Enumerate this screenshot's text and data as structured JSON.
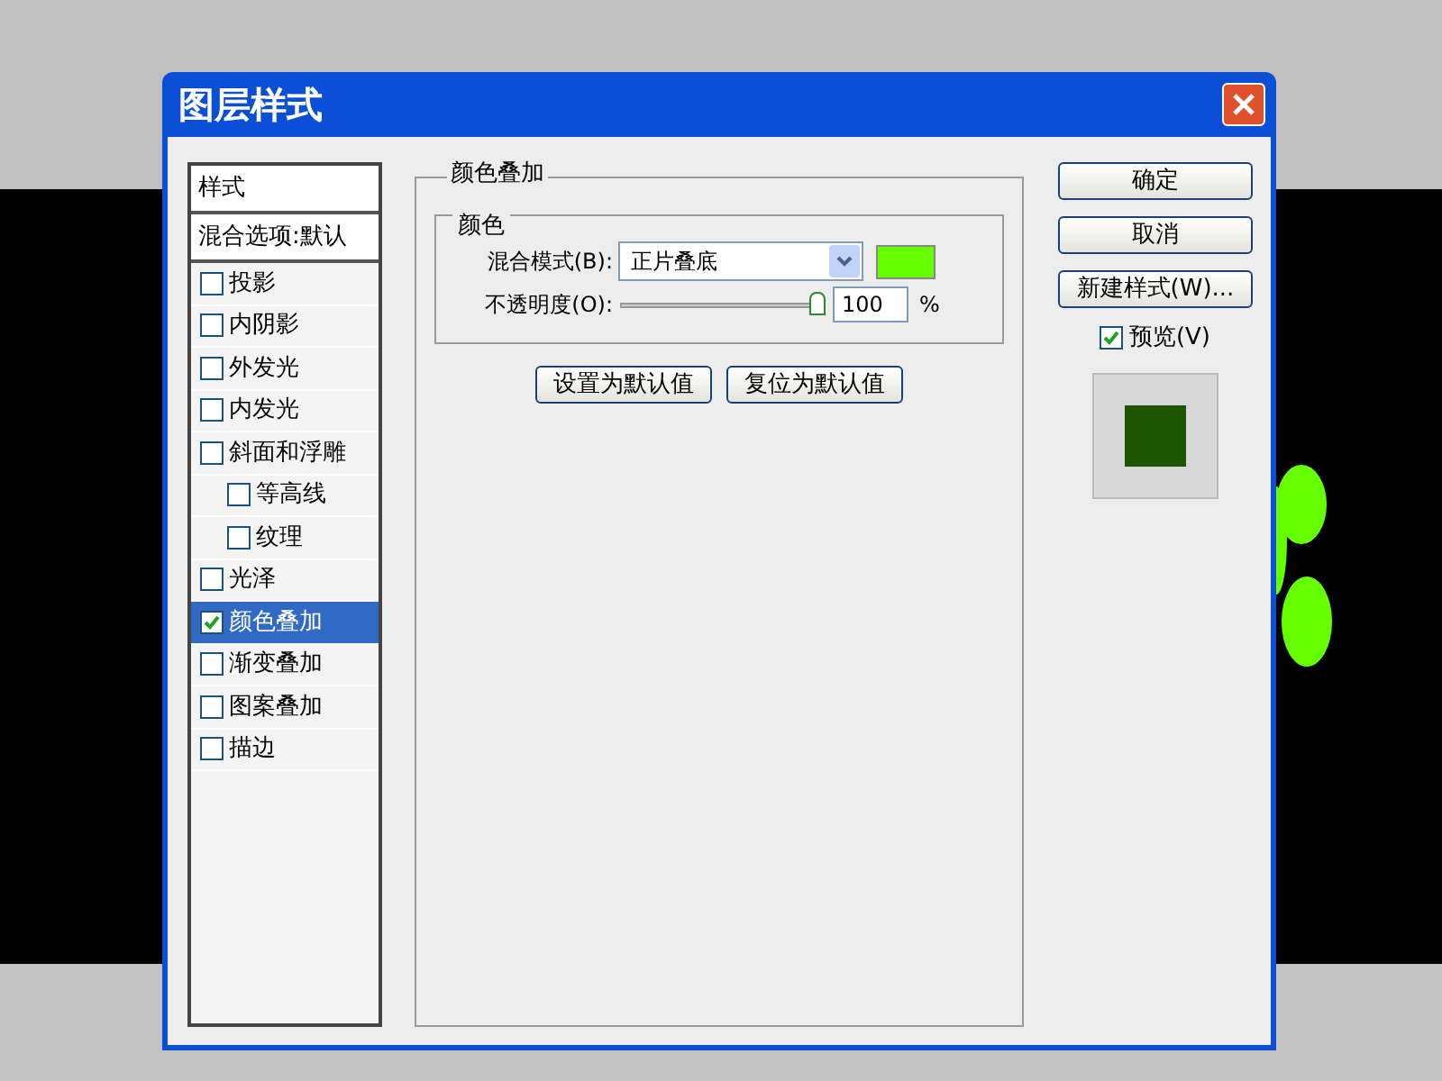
{
  "window": {
    "title": "图层样式"
  },
  "sidebar": {
    "items": [
      {
        "kind": "header",
        "label": "样式"
      },
      {
        "kind": "header",
        "label": "混合选项:默认"
      },
      {
        "kind": "check",
        "label": "投影",
        "checked": false,
        "selected": false
      },
      {
        "kind": "check",
        "label": "内阴影",
        "checked": false,
        "selected": false
      },
      {
        "kind": "check",
        "label": "外发光",
        "checked": false,
        "selected": false
      },
      {
        "kind": "check",
        "label": "内发光",
        "checked": false,
        "selected": false
      },
      {
        "kind": "check",
        "label": "斜面和浮雕",
        "checked": false,
        "selected": false,
        "children": [
          {
            "kind": "check",
            "label": "等高线",
            "checked": false,
            "selected": false
          },
          {
            "kind": "check",
            "label": "纹理",
            "checked": false,
            "selected": false
          }
        ]
      },
      {
        "kind": "check",
        "label": "光泽",
        "checked": false,
        "selected": false
      },
      {
        "kind": "check",
        "label": "颜色叠加",
        "checked": true,
        "selected": true
      },
      {
        "kind": "check",
        "label": "渐变叠加",
        "checked": false,
        "selected": false
      },
      {
        "kind": "check",
        "label": "图案叠加",
        "checked": false,
        "selected": false
      },
      {
        "kind": "check",
        "label": "描边",
        "checked": false,
        "selected": false
      }
    ]
  },
  "panel": {
    "title": "颜色叠加",
    "group_title": "颜色",
    "blend_mode": {
      "label": "混合模式(B):",
      "value": "正片叠底",
      "color": "#66ff00"
    },
    "opacity": {
      "label": "不透明度(O):",
      "level": 1,
      "value": "100",
      "unit": "%"
    },
    "buttons": [
      "设置为默认值",
      "复位为默认值"
    ]
  },
  "actions": {
    "buttons": [
      "确定",
      "取消",
      "新建样式(W)..."
    ],
    "preview": {
      "label": "预览(V)",
      "checked": true
    }
  }
}
